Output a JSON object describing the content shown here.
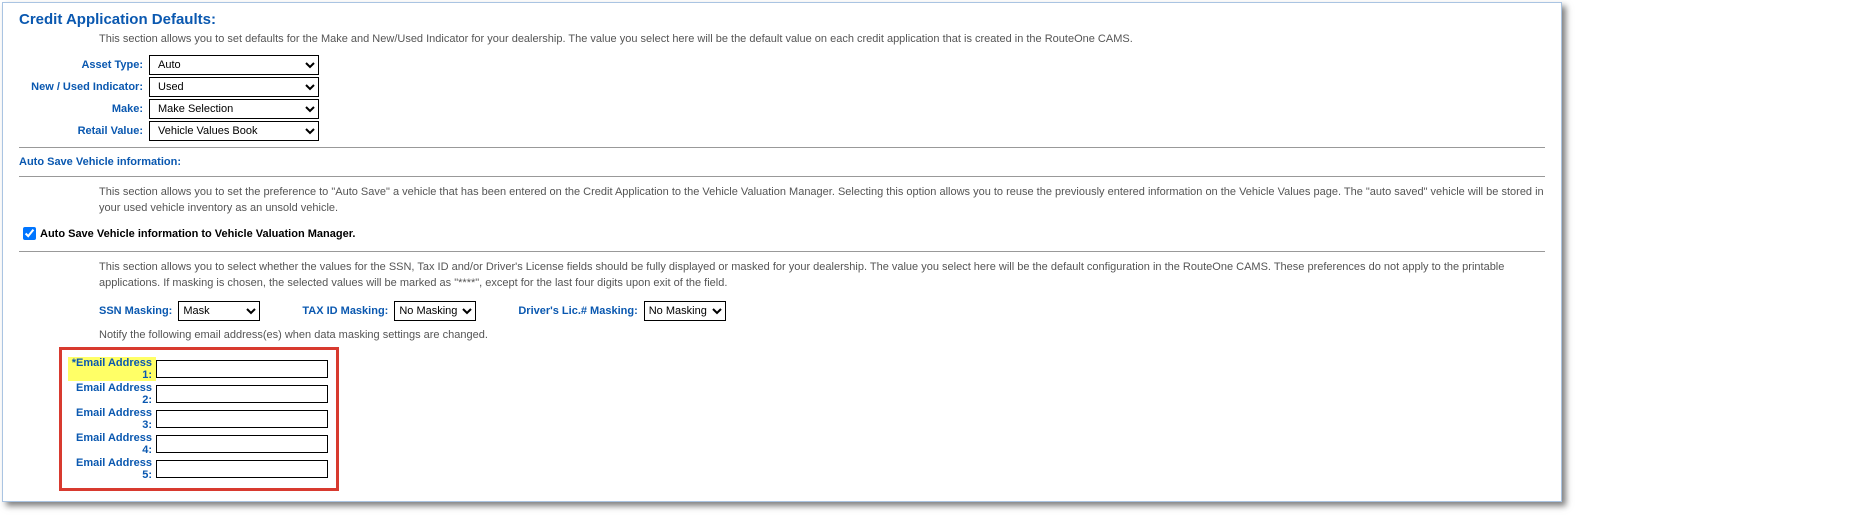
{
  "header": {
    "title": "Credit Application Defaults:",
    "description": "This section allows you to set defaults for the Make and New/Used Indicator for your dealership. The value you select here will be the default value on each credit application that is created in the RouteOne CAMS."
  },
  "fields": {
    "asset_type": {
      "label": "Asset Type:",
      "value": "Auto"
    },
    "new_used": {
      "label": "New / Used Indicator:",
      "value": "Used"
    },
    "make": {
      "label": "Make:",
      "value": "Make Selection"
    },
    "retail_value": {
      "label": "Retail Value:",
      "value": "Vehicle Values Book"
    }
  },
  "auto_save": {
    "title": "Auto Save Vehicle information:",
    "description": "This section allows you to set the preference to \"Auto Save\" a vehicle that has been entered on the Credit Application to the Vehicle Valuation Manager. Selecting this option allows you to reuse the previously entered information on the Vehicle Values page. The \"auto saved\" vehicle will be stored in your used vehicle inventory as an unsold vehicle.",
    "checkbox_label": "Auto Save Vehicle information to Vehicle Valuation Manager."
  },
  "masking": {
    "description": "This section allows you to select whether the values for the SSN, Tax ID and/or Driver's License fields should be fully displayed or masked for your dealership. The value you select here will be the default configuration in the RouteOne CAMS. These preferences do not apply to the printable applications. If masking is chosen, the selected values will be marked as \"****\", except for the last four digits upon exit of the field.",
    "ssn": {
      "label": "SSN Masking:",
      "value": "Mask"
    },
    "tax": {
      "label": "TAX ID Masking:",
      "value": "No Masking"
    },
    "dl": {
      "label": "Driver's Lic.# Masking:",
      "value": "No Masking"
    },
    "notify_text": "Notify the following email address(es) when data masking settings are changed."
  },
  "emails": {
    "e1": {
      "label": "*Email Address 1:",
      "value": ""
    },
    "e2": {
      "label": "Email Address 2:",
      "value": ""
    },
    "e3": {
      "label": "Email Address 3:",
      "value": ""
    },
    "e4": {
      "label": "Email Address 4:",
      "value": ""
    },
    "e5": {
      "label": "Email Address 5:",
      "value": ""
    }
  }
}
